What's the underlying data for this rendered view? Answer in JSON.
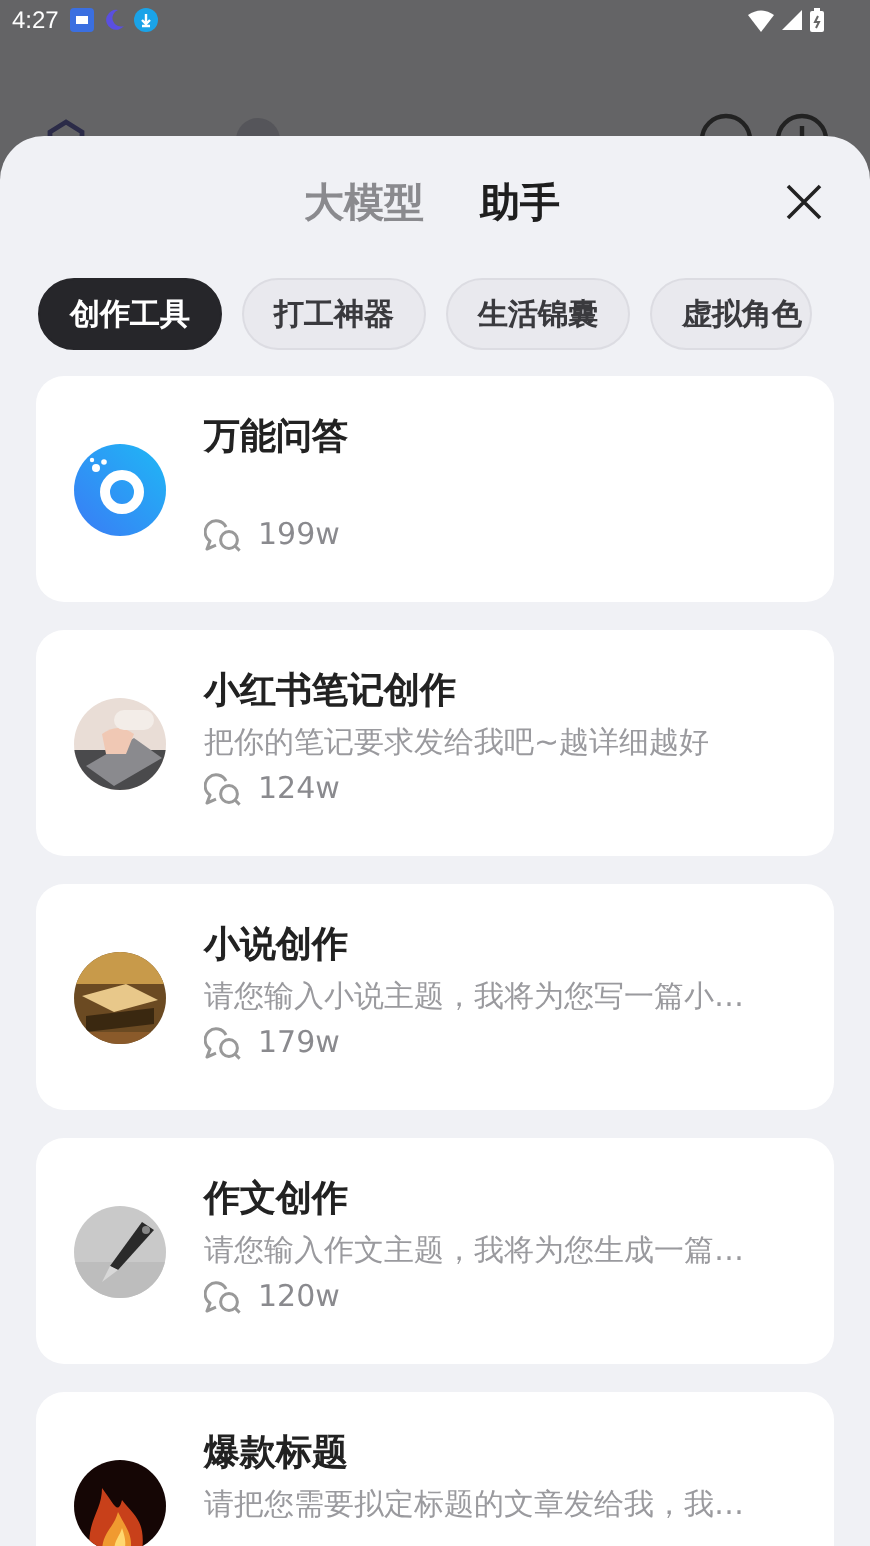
{
  "status_bar": {
    "time": "4:27"
  },
  "sheet": {
    "tabs": [
      {
        "label": "大模型",
        "selected": false
      },
      {
        "label": "助手",
        "selected": true
      }
    ],
    "categories": [
      {
        "label": "创作工具",
        "selected": true
      },
      {
        "label": "打工神器",
        "selected": false
      },
      {
        "label": "生活锦囊",
        "selected": false
      },
      {
        "label": "虚拟角色",
        "selected": false
      }
    ],
    "assistants": [
      {
        "kind": "logo",
        "title": "万能问答",
        "count": "199w"
      },
      {
        "kind": "picture",
        "title": "小红书笔记创作",
        "description": "把你的笔记要求发给我吧~越详细越好",
        "count": "124w"
      },
      {
        "kind": "picture",
        "title": "小说创作",
        "description": "请您输入小说主题，我将为您写一篇小…",
        "count": "179w"
      },
      {
        "kind": "picture",
        "title": "作文创作",
        "description": "请您输入作文主题，我将为您生成一篇…",
        "count": "120w"
      },
      {
        "kind": "picture",
        "title": "爆款标题",
        "description": "请把您需要拟定标题的文章发给我，我…"
      }
    ]
  }
}
